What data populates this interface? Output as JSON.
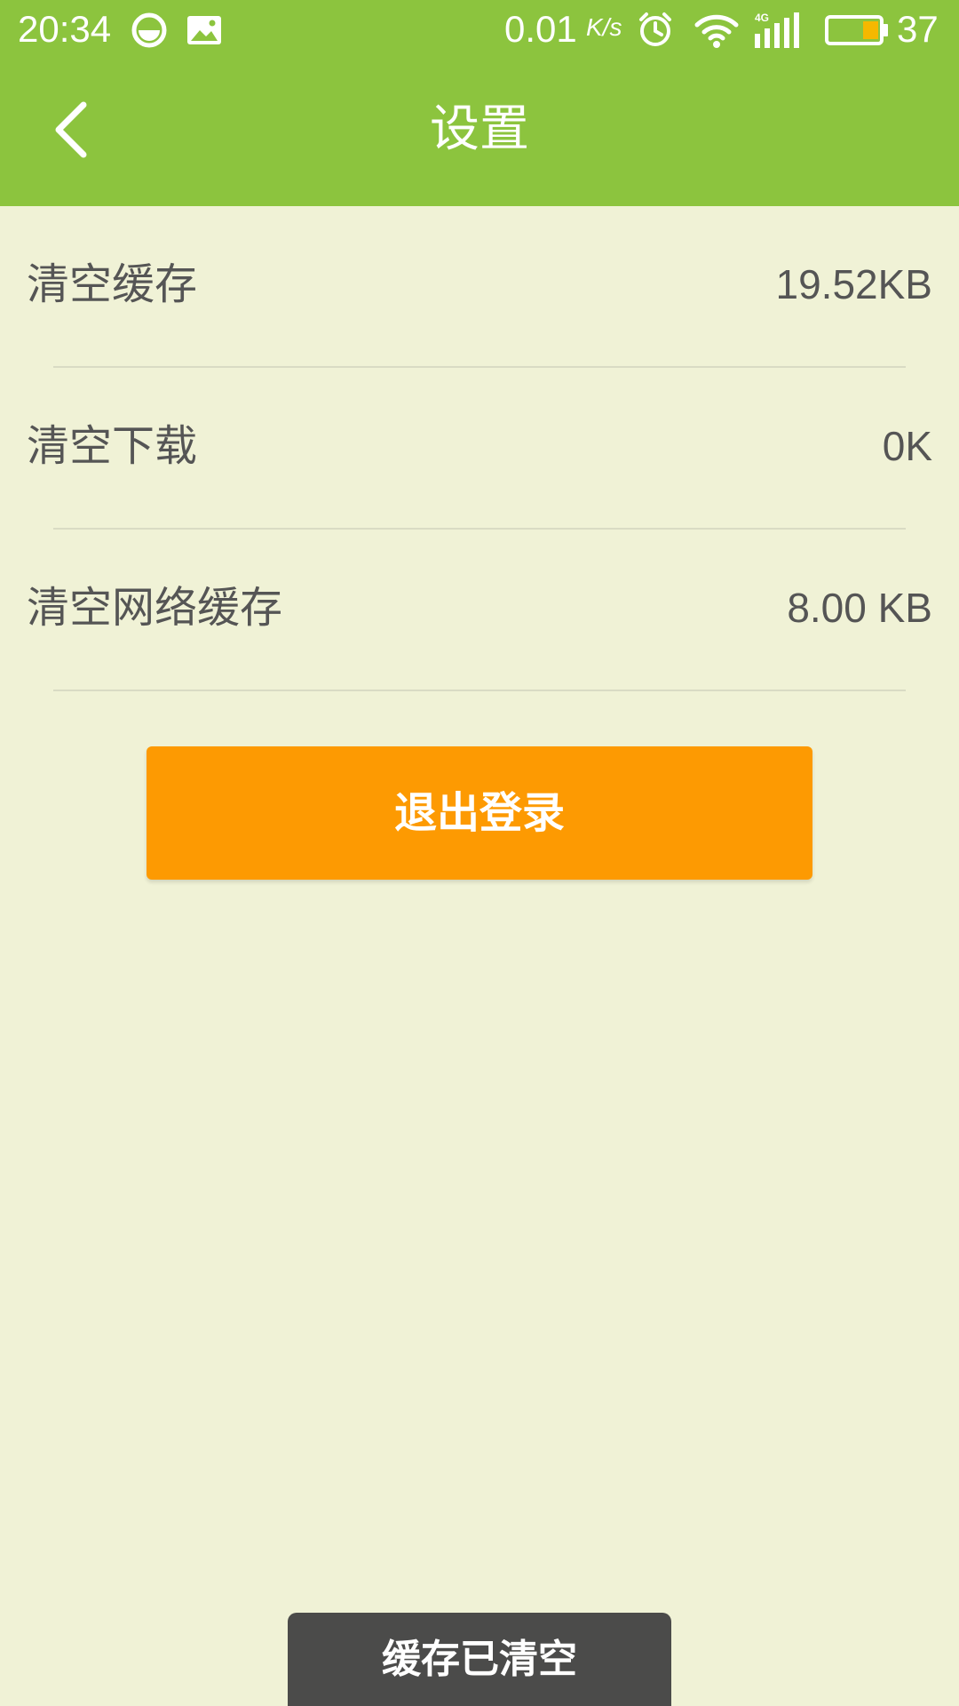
{
  "status_bar": {
    "time": "20:34",
    "net_speed": "0.01",
    "net_speed_unit": "K/s",
    "battery_percent": "37",
    "network_type": "4G",
    "icons": [
      "app-notification-icon",
      "image-icon",
      "alarm-icon",
      "wifi-icon",
      "signal-icon",
      "battery-icon"
    ],
    "battery_level": 0.37
  },
  "header": {
    "title": "设置",
    "back_icon": "chevron-left-icon"
  },
  "settings": {
    "items": [
      {
        "label": "清空缓存",
        "value": "19.52KB"
      },
      {
        "label": "清空下载",
        "value": "0K"
      },
      {
        "label": "清空网络缓存",
        "value": "8.00 KB"
      }
    ]
  },
  "logout_button": {
    "label": "退出登录"
  },
  "toast": {
    "message": "缓存已清空"
  },
  "colors": {
    "header_bg": "#8cc43e",
    "page_bg": "#f0f2d6",
    "logout_bg": "#fd9a02",
    "toast_bg": "#4b4b4a",
    "text": "#555555",
    "battery_fill": "#f5b800"
  }
}
